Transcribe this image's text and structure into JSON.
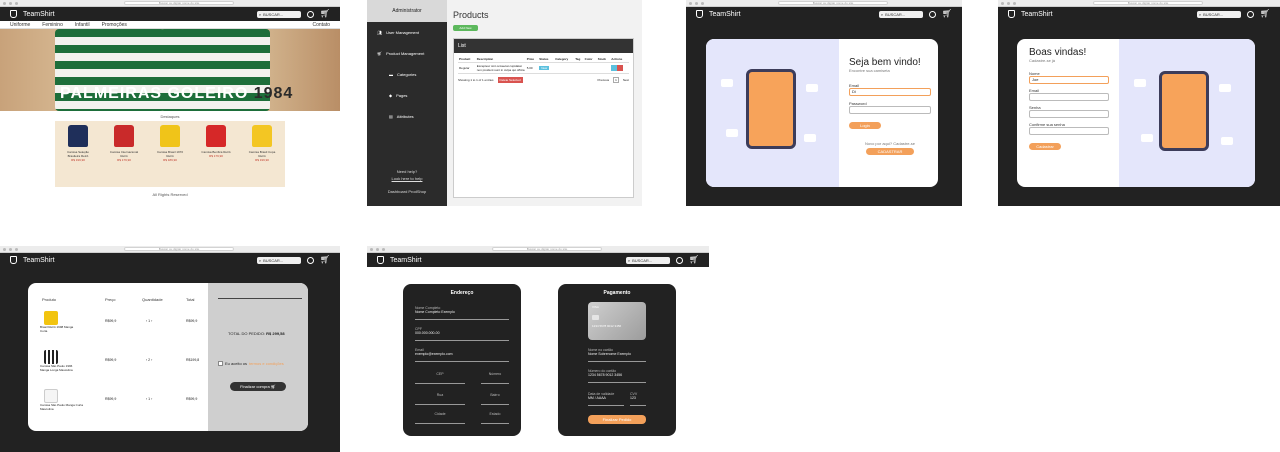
{
  "common": {
    "url_placeholder": "Buscar ou digitar nome do site",
    "brand": "TeamShirt",
    "search_placeholder": "BUSCAR..."
  },
  "store": {
    "nav": [
      "Uniforme",
      "Feminino",
      "Infantil",
      "Promoções"
    ],
    "nav_right": "Contato",
    "hero_title": "PALMEIRAS GOLEIRO",
    "hero_year": "1984",
    "highlights": "Destaques",
    "products": [
      {
        "name": "Camisa Seleção Brasileira Retrô",
        "price": "R$ 199,90",
        "color": "#1f2f5a"
      },
      {
        "name": "Camisa Internacional Retrô",
        "price": "R$ 179,90",
        "color": "#c92a2a"
      },
      {
        "name": "Camisa Brasil 1970 Retrô",
        "price": "R$ 189,90",
        "color": "#f0c419"
      },
      {
        "name": "Camisa Benfica Retrô",
        "price": "R$ 179,90",
        "color": "#d62828"
      },
      {
        "name": "Camisa Brasil Copa Retrô",
        "price": "R$ 199,90",
        "color": "#f3c623"
      }
    ],
    "footer": "All Rights Reserved"
  },
  "admin": {
    "title": "Administrator",
    "menu": [
      "User Management",
      "Product Management"
    ],
    "submenu": [
      "Categories",
      "Pages",
      "Attributes"
    ],
    "help": "Need help?",
    "help_link": "Look here to help",
    "footer": "Dashboard ProdShop",
    "page_title": "Products",
    "new_button": "Add New",
    "list_title": "List",
    "columns": [
      "Product",
      "Description",
      "Price",
      "Status",
      "Category",
      "Tag",
      "Color",
      "Stock",
      "Actions"
    ],
    "row": [
      "Regular",
      "Excepteur sint occaecat cupidatat non proident sunt in culpa qui officia",
      "5.00",
      "New",
      "",
      "",
      "",
      "",
      ""
    ],
    "showing": "Showing 1 to 1 of 1 entries",
    "delete_label": "Delete Selected",
    "pagination": [
      "Previous",
      "1",
      "Next"
    ]
  },
  "login": {
    "title": "Seja bem vindo!",
    "subtitle": "Encontre sua camiseta",
    "email_label": "Email",
    "email_value": "Di",
    "password_label": "Password",
    "login_button": "Login",
    "new_here": "Novo por aqui? Cadastre-se",
    "register_button": "CADASTRAR"
  },
  "register": {
    "title": "Boas vindas!",
    "subtitle": "Cadastre-se já",
    "fields": [
      "Nome",
      "Email",
      "Senha",
      "Confirme sua senha"
    ],
    "name_value": "Joe",
    "button": "Cadastrar"
  },
  "cart": {
    "headers": [
      "Produto",
      "Preço",
      "Quantidade",
      "Total"
    ],
    "items": [
      {
        "name": "Brasil Retrô 1998 Manga Curta",
        "price": "R$99,9",
        "qty": "1",
        "total": "R$99,9",
        "color": "#f2c40f"
      },
      {
        "name": "Camisa São Paulo 1996 Manga Longa Masculina",
        "price": "R$99,9",
        "qty": "2",
        "total": "R$199,8",
        "color": "#333333"
      },
      {
        "name": "Camisa São Paulo Manga Curta Masculina",
        "price": "R$99,9",
        "qty": "1",
        "total": "R$99,9",
        "color": "#f5f5f5"
      }
    ],
    "total_label": "TOTAL DO PEDIDO:",
    "total_value": "R$ 299,58",
    "terms": "Eu aceito os",
    "terms_link": "termos e condições",
    "checkout_button": "Finalizar compra"
  },
  "checkout": {
    "address_title": "Endereço",
    "address_fields": [
      "Nome Completo",
      "CPF",
      "Email",
      "CEP",
      "Número",
      "Rua",
      "Bairro",
      "Cidade",
      "Estado"
    ],
    "address_values": [
      "Nome Completo Exemplo",
      "000.000.000-00",
      "exemplo@exemplo.com",
      "",
      "",
      "",
      "",
      "",
      ""
    ],
    "payment_title": "Pagamento",
    "payment_fields": [
      "Nome no cartão",
      "Número do cartão",
      "Data de validade",
      "CVV"
    ],
    "payment_values": [
      "Nome Sobrenome Exemplo",
      "1234 5678 9012 3456",
      "MM / AAAA",
      "123"
    ],
    "card_brand": "VISA",
    "confirm_button": "Finalizar Pedido"
  }
}
